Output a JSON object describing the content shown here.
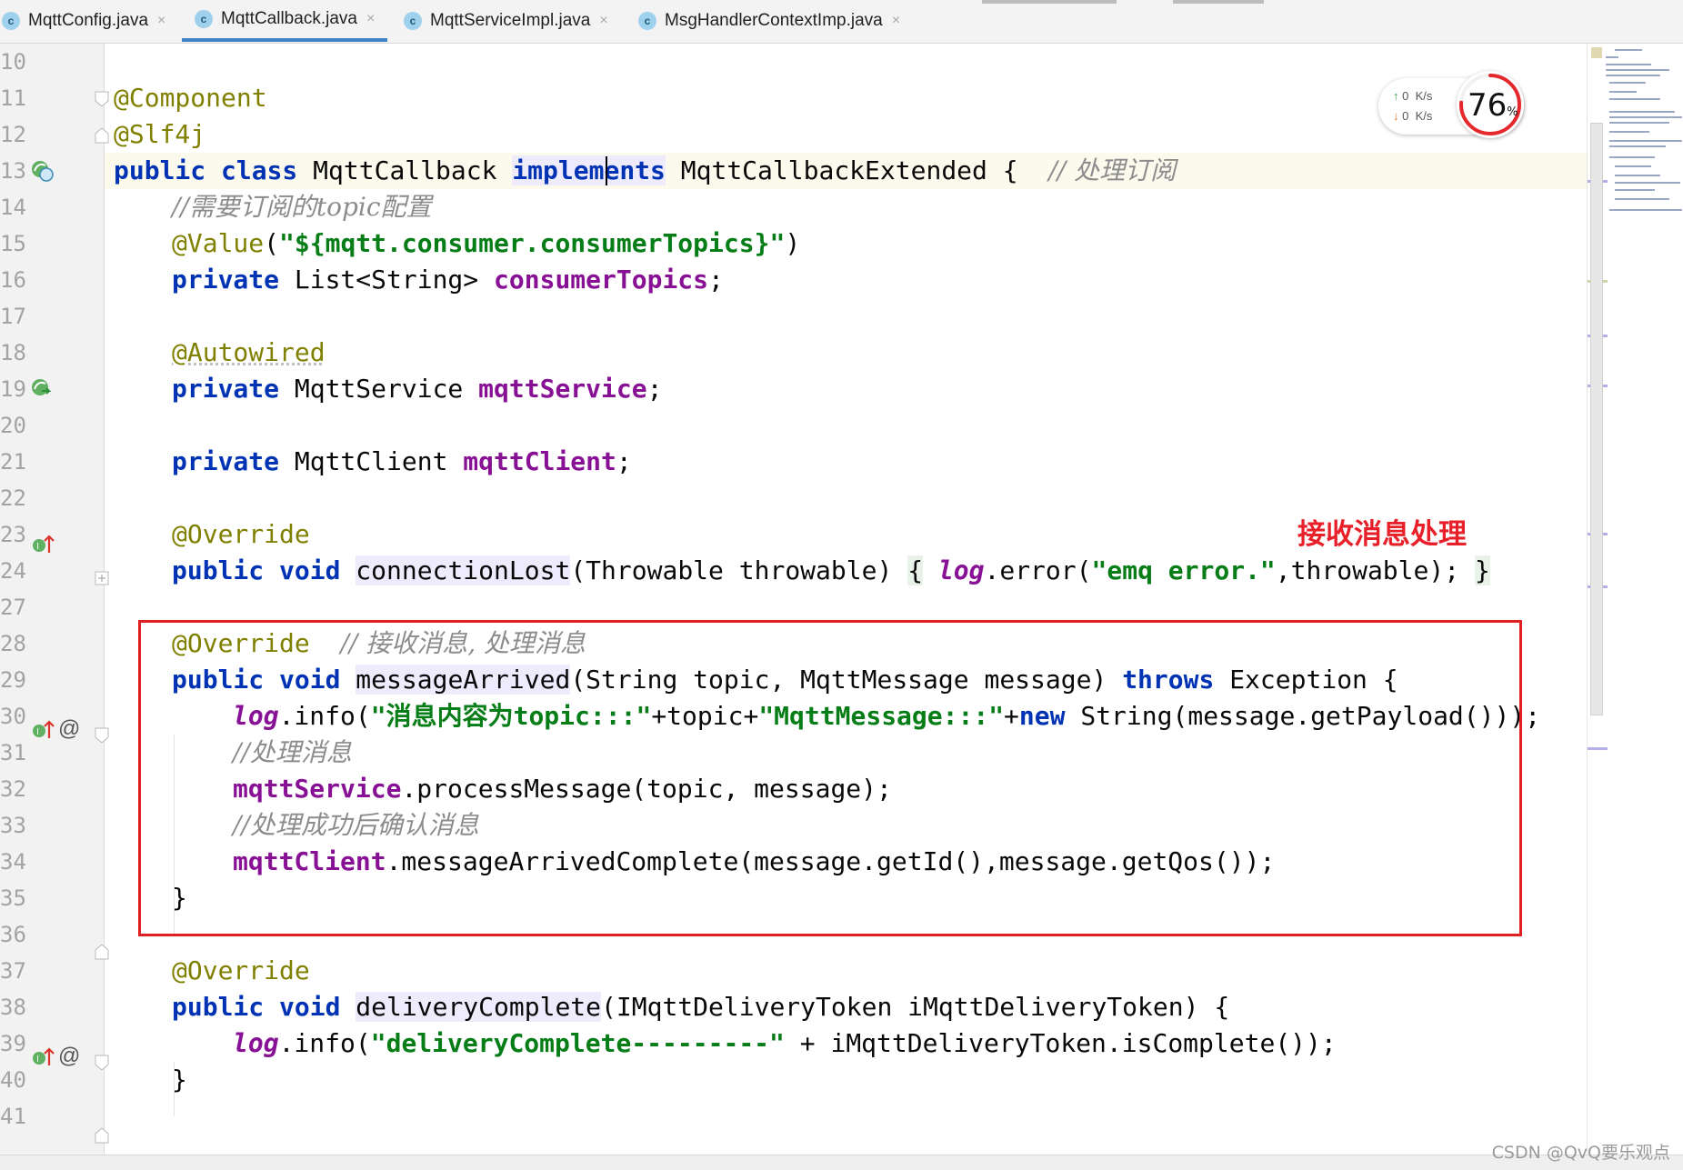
{
  "tabs": [
    {
      "label": "MqttConfig.java",
      "icon": "class-icon",
      "active": false
    },
    {
      "label": "MqttCallback.java",
      "icon": "class-icon",
      "active": true
    },
    {
      "label": "MqttServiceImpl.java",
      "icon": "class-icon",
      "active": false
    },
    {
      "label": "MsgHandlerContextImp.java",
      "icon": "class-icon",
      "active": false
    }
  ],
  "tab_close_glyph": "×",
  "class_icon_letter": "c",
  "line_numbers": [
    "10",
    "11",
    "12",
    "13",
    "14",
    "15",
    "16",
    "17",
    "18",
    "19",
    "20",
    "21",
    "22",
    "23",
    "24",
    "27",
    "28",
    "29",
    "30",
    "31",
    "32",
    "33",
    "34",
    "35",
    "36",
    "37",
    "38",
    "39",
    "40",
    "41"
  ],
  "code": {
    "l11": "@Component",
    "l12": "@Slf4j",
    "l13_kw": "public class ",
    "l13_name": "MqttCallback ",
    "l13_impl": "implements",
    "l13_rest": " MqttCallbackExtended {  ",
    "l13_cm": "// 处理订阅",
    "l14": "//需要订阅的topic配置",
    "l15_an": "@Value",
    "l15_p1": "(",
    "l15_st": "\"${mqtt.consumer.consumerTopics}\"",
    "l15_p2": ")",
    "l16_kw": "private ",
    "l16_type": "List<String> ",
    "l16_fld": "consumerTopics",
    "l16_end": ";",
    "l18": "@Autowired",
    "l19_kw": "private ",
    "l19_type": "MqttService ",
    "l19_fld": "mqttService",
    "l19_end": ";",
    "l21_kw": "private ",
    "l21_type": "MqttClient ",
    "l21_fld": "mqttClient",
    "l21_end": ";",
    "l23": "@Override",
    "l24_kw": "public void ",
    "l24_m": "connectionLost",
    "l24_p": "(Throwable throwable) ",
    "l24_b1": "{",
    "l24_log": "log",
    "l24_call": ".error(",
    "l24_st": "\"emq error.\"",
    "l24_rest": ",throwable); ",
    "l24_b2": "}",
    "l28_an": "@Override",
    "l28_cm": "// 接收消息, 处理消息",
    "l29_kw": "public void ",
    "l29_m": "messageArrived",
    "l29_p": "(String topic, MqttMessage message) ",
    "l29_throws": "throws",
    "l29_rest": " Exception {",
    "l30_log": "log",
    "l30_call": ".info(",
    "l30_st1": "\"消息内容为topic:::\"",
    "l30_mid": "+topic+",
    "l30_st2": "\"MqttMessage:::\"",
    "l30_plus": "+",
    "l30_new": "new",
    "l30_rest": " String(message.getPayload()));",
    "l31": "//处理消息",
    "l32_fld": "mqttService",
    "l32_rest": ".processMessage(topic, message);",
    "l33": "//处理成功后确认消息",
    "l34_fld": "mqttClient",
    "l34_rest": ".messageArrivedComplete(message.getId(),message.getQos());",
    "l35": "}",
    "l37": "@Override",
    "l38_kw": "public void ",
    "l38_m": "deliveryComplete",
    "l38_rest": "(IMqttDeliveryToken iMqttDeliveryToken) {",
    "l39_log": "log",
    "l39_call": ".info(",
    "l39_st": "\"deliveryComplete---------\"",
    "l39_rest": " + iMqttDeliveryToken.isComplete());",
    "l40": "}"
  },
  "annotation_label": "接收消息处理",
  "net_widget": {
    "up_value": "0",
    "up_unit": "K/s",
    "down_value": "0",
    "down_unit": "K/s",
    "up_arrow": "↑",
    "down_arrow": "↓"
  },
  "cpu_percent": {
    "value": "76",
    "unit": "%"
  },
  "override_marker": "@",
  "watermark": "CSDN @QvQ要乐观点",
  "colors": {
    "accent_tab": "#4083c9",
    "annotation_red": "#e8202a",
    "box_red": "#e02020"
  }
}
